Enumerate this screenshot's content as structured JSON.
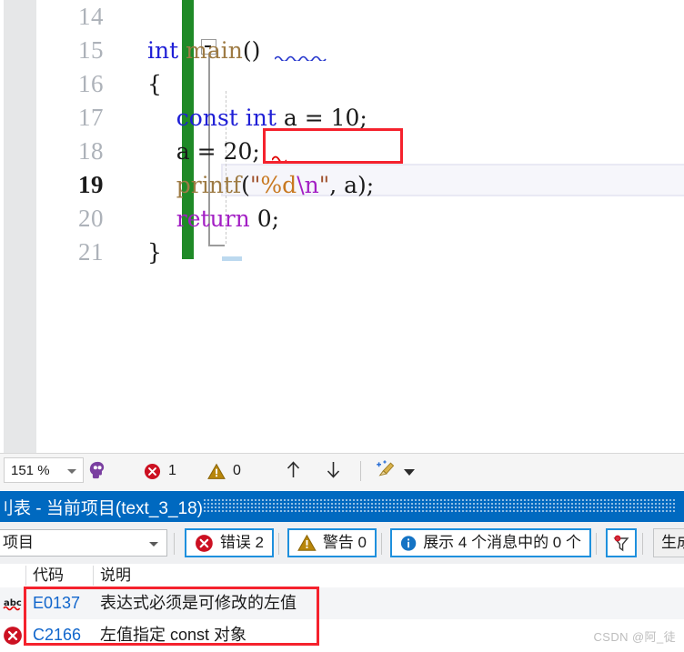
{
  "editor": {
    "lines": [
      {
        "num": "14",
        "current": false,
        "tokens": []
      },
      {
        "num": "15",
        "current": false,
        "tokens": [
          {
            "t": "int",
            "c": "kw"
          },
          {
            "t": " ",
            "c": "plain"
          },
          {
            "t": "main",
            "c": "fn"
          },
          {
            "t": "()",
            "c": "plain"
          }
        ]
      },
      {
        "num": "16",
        "current": false,
        "tokens": [
          {
            "t": "{",
            "c": "plain"
          }
        ]
      },
      {
        "num": "17",
        "current": false,
        "tokens": [
          {
            "t": "    ",
            "c": "plain"
          },
          {
            "t": "const int",
            "c": "kw"
          },
          {
            "t": " a = 10;",
            "c": "plain"
          }
        ]
      },
      {
        "num": "18",
        "current": false,
        "tokens": [
          {
            "t": "    a = 20;",
            "c": "plain"
          }
        ]
      },
      {
        "num": "19",
        "current": true,
        "tokens": [
          {
            "t": "    ",
            "c": "plain"
          },
          {
            "t": "printf",
            "c": "fn"
          },
          {
            "t": "(",
            "c": "plain"
          },
          {
            "t": "\"",
            "c": "str"
          },
          {
            "t": "%d",
            "c": "fmt"
          },
          {
            "t": "\\n",
            "c": "esc"
          },
          {
            "t": "\"",
            "c": "str"
          },
          {
            "t": ", a);",
            "c": "plain"
          }
        ]
      },
      {
        "num": "20",
        "current": false,
        "tokens": [
          {
            "t": "    ",
            "c": "plain"
          },
          {
            "t": "return",
            "c": "ret"
          },
          {
            "t": " 0;",
            "c": "plain"
          }
        ]
      },
      {
        "num": "21",
        "current": false,
        "tokens": [
          {
            "t": "}",
            "c": "plain"
          }
        ]
      }
    ],
    "annotation_color": "#f5222d",
    "change_bar_color": "#1f8a27"
  },
  "zoombar": {
    "zoom_value": "151 %",
    "intellisense_icon": "intellisense-head-icon",
    "error_icon": "error-circle-icon",
    "error_count": "1",
    "warning_icon": "warning-triangle-icon",
    "warning_count": "0",
    "prev_icon": "arrow-up-icon",
    "next_icon": "arrow-down-icon",
    "broom_icon": "broom-icon",
    "broom_caret": "chevron-down-icon"
  },
  "panel": {
    "title": "刂表 - 当前项目(text_3_18)"
  },
  "error_toolbar": {
    "scope_value": "项目",
    "errors_label": "错误 2",
    "warnings_label": "警告 0",
    "messages_label": "展示 4 个消息中的 0 个",
    "filter_icon": "filter-funnel-icon",
    "build_label": "生成"
  },
  "error_list": {
    "columns": [
      "代码",
      "说明"
    ],
    "rows": [
      {
        "icon": "squiggle-abc-icon",
        "code": "E0137",
        "description": "表达式必须是可修改的左值"
      },
      {
        "icon": "error-circle-icon",
        "code": "C2166",
        "description": "左值指定 const 对象"
      }
    ]
  },
  "watermark": {
    "text": "CSDN @阿_徒"
  }
}
